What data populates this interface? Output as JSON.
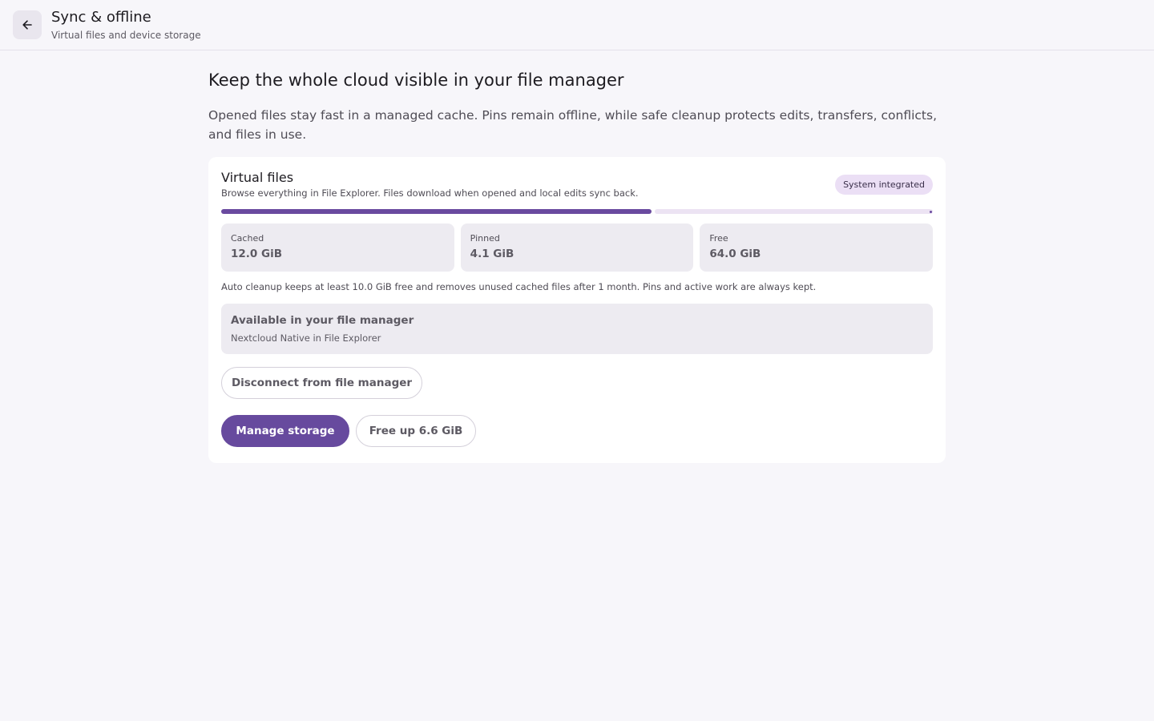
{
  "header": {
    "title": "Sync & offline",
    "subtitle": "Virtual files and device storage",
    "back_icon": "arrow-left-icon"
  },
  "main": {
    "headline": "Keep the whole cloud visible in your file manager",
    "intro": "Opened files stay fast in a managed cache. Pins remain offline, while safe cleanup protects edits, transfers, conflicts, and files in use."
  },
  "virtual_files": {
    "title": "Virtual files",
    "description": "Browse everything in File Explorer. Files download when opened and local edits sync back.",
    "badge": "System integrated",
    "usage_fraction": 0.605,
    "stats": [
      {
        "label": "Cached",
        "value": "12.0 GiB"
      },
      {
        "label": "Pinned",
        "value": "4.1 GiB"
      },
      {
        "label": "Free",
        "value": "64.0 GiB"
      }
    ],
    "cleanup_note": "Auto cleanup keeps at least 10.0 GiB free and removes unused cached files after 1 month. Pins and active work are always kept.",
    "file_manager": {
      "title": "Available in your file manager",
      "subtitle": "Nextcloud Native in File Explorer"
    },
    "buttons": {
      "disconnect": "Disconnect from file manager",
      "manage": "Manage storage",
      "free_up": "Free up 6.6 GiB"
    }
  },
  "colors": {
    "accent": "#674a9e",
    "badge_bg": "#ebdff5",
    "page_bg": "#f7f6fa"
  }
}
